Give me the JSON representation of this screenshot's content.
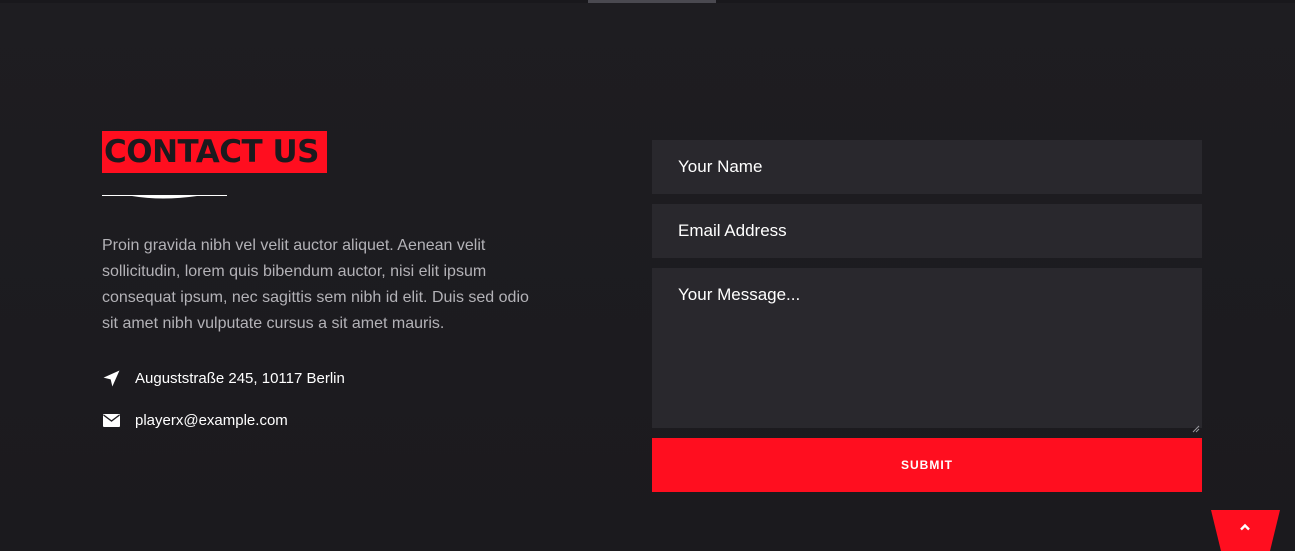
{
  "contact": {
    "title": "CONTACT US",
    "intro": "Proin gravida nibh vel velit auctor aliquet. Aenean velit sollicitudin, lorem quis bibendum auctor, nisi elit ipsum consequat ipsum, nec sagittis sem nibh id elit. Duis sed odio sit amet nibh vulputate cursus a sit amet mauris.",
    "address": {
      "icon": "location-arrow-icon",
      "text": "Auguststraße 245, 10117 Berlin"
    },
    "email": {
      "icon": "envelope-icon",
      "text": "playerx@example.com"
    }
  },
  "form": {
    "name_placeholder": "Your Name",
    "email_placeholder": "Email Address",
    "message_placeholder": "Your Message...",
    "submit_label": "SUBMIT"
  },
  "back_to_top": {
    "icon": "chevron-up-icon"
  },
  "colors": {
    "accent": "#ff0e1f",
    "background": "#1c1b1f",
    "field": "#29282d"
  }
}
